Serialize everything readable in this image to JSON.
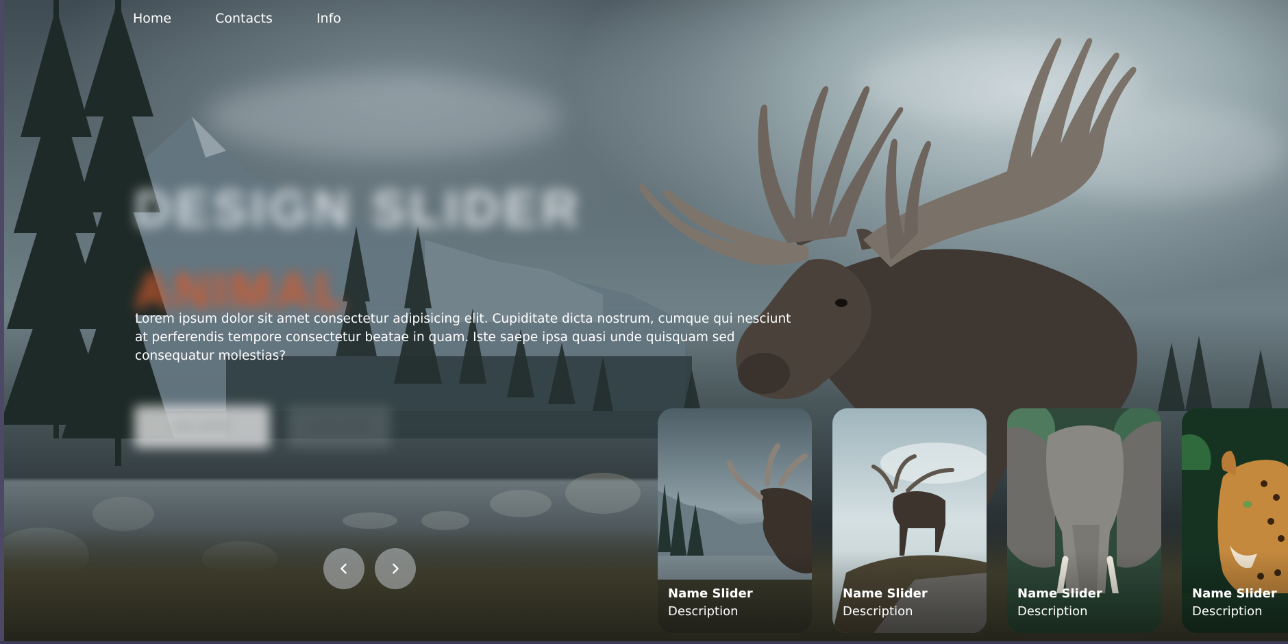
{
  "nav": {
    "items": [
      "Home",
      "Contacts",
      "Info"
    ]
  },
  "hero": {
    "title": "DESIGN SLIDER",
    "topic": "ANIMAL",
    "description": "Lorem ipsum dolor sit amet consectetur adipisicing elit. Cupiditate dicta nostrum, cumque qui nesciunt at perferendis tempore consectetur beatae in quam. Iste saepe ipsa quasi unde quisquam sed consequatur molestias?",
    "buttons": [
      "SEE MORE",
      "SUBSCRIBE"
    ]
  },
  "arrows": {
    "prev": "<",
    "next": ">"
  },
  "thumbnails": [
    {
      "name": "Name Slider",
      "description": "Description",
      "animal": "moose-mountain-lake"
    },
    {
      "name": "Name Slider",
      "description": "Description",
      "animal": "moose-on-rock"
    },
    {
      "name": "Name Slider",
      "description": "Description",
      "animal": "elephant"
    },
    {
      "name": "Name Slider",
      "description": "Description",
      "animal": "leopard"
    }
  ],
  "colors": {
    "accent": "#d05a2e",
    "arrow_bg": "#bec3c8"
  }
}
